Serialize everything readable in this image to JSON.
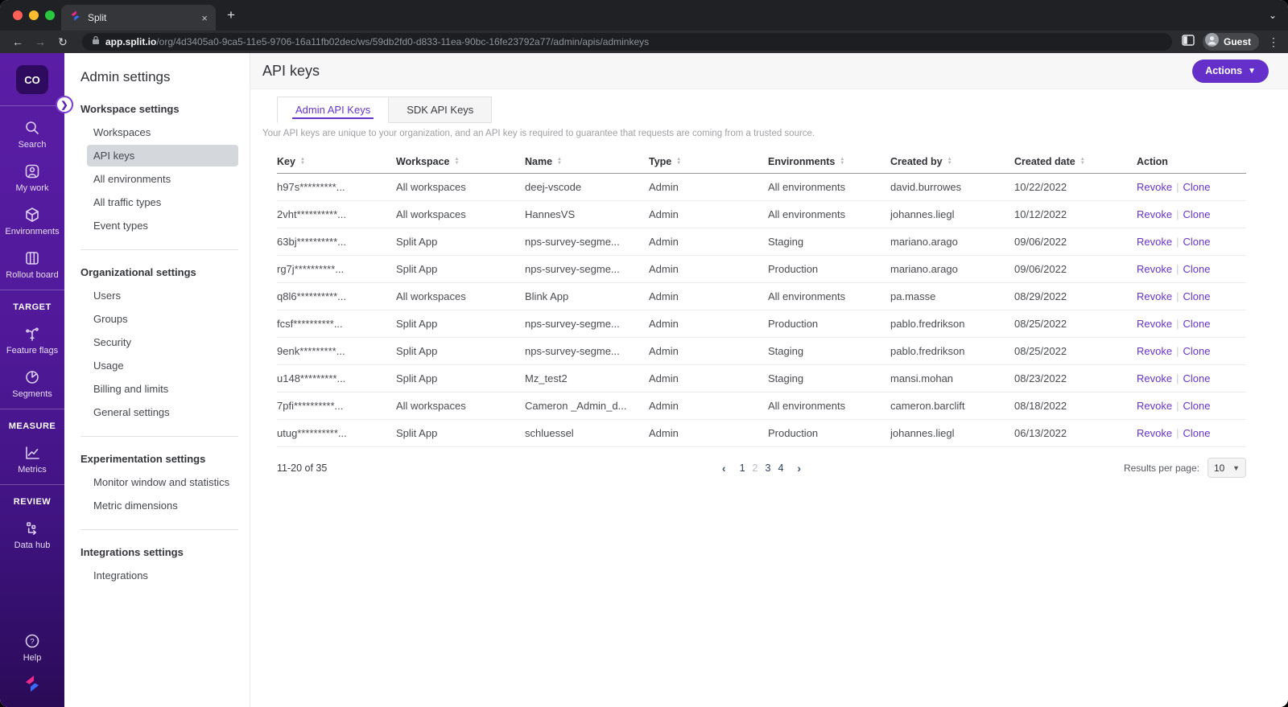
{
  "browser": {
    "tab_title": "Split",
    "new_tab_glyph": "+",
    "close_glyph": "×",
    "back_glyph": "←",
    "forward_glyph": "→",
    "reload_glyph": "↻",
    "url_domain": "app.split.io",
    "url_path": "/org/4d3405a0-9ca5-11e5-9706-16a11fb02dec/ws/59db2fd0-d833-11ea-90bc-16fe23792a77/admin/apis/adminkeys",
    "profile_label": "Guest",
    "kebab_glyph": "⋮",
    "strip_chevron_glyph": "⌄"
  },
  "rail": {
    "logo_text": "CO",
    "expander_glyph": "❯",
    "groups": [
      {
        "header": null,
        "items": [
          {
            "icon": "search-icon",
            "label": "Search"
          },
          {
            "icon": "my-work-icon",
            "label": "My work"
          },
          {
            "icon": "environments-cube-icon",
            "label": "Environments"
          },
          {
            "icon": "rollout-board-icon",
            "label": "Rollout board"
          }
        ]
      },
      {
        "header": "TARGET",
        "items": [
          {
            "icon": "feature-flags-icon",
            "label": "Feature flags"
          },
          {
            "icon": "segments-pie-icon",
            "label": "Segments"
          }
        ]
      },
      {
        "header": "MEASURE",
        "items": [
          {
            "icon": "metrics-chart-icon",
            "label": "Metrics"
          }
        ]
      },
      {
        "header": "REVIEW",
        "items": [
          {
            "icon": "data-hub-icon",
            "label": "Data hub"
          }
        ]
      }
    ],
    "help_label": "Help"
  },
  "admin_nav": {
    "title": "Admin settings",
    "groups": [
      {
        "header": "Workspace settings",
        "selected": "API keys",
        "items": [
          "Workspaces",
          "API keys",
          "All environments",
          "All traffic types",
          "Event types"
        ]
      },
      {
        "header": "Organizational settings",
        "selected": null,
        "items": [
          "Users",
          "Groups",
          "Security",
          "Usage",
          "Billing and limits",
          "General settings"
        ]
      },
      {
        "header": "Experimentation settings",
        "selected": null,
        "items": [
          "Monitor window and statistics",
          "Metric dimensions"
        ]
      },
      {
        "header": "Integrations settings",
        "selected": null,
        "items": [
          "Integrations"
        ]
      }
    ]
  },
  "main": {
    "title": "API keys",
    "actions_label": "Actions",
    "tabs": [
      {
        "label": "Admin API Keys",
        "active": true
      },
      {
        "label": "SDK API Keys",
        "active": false
      }
    ],
    "description": "Your API keys are unique to your organization, and an API key is required to guarantee that requests are coming from a trusted source.",
    "table": {
      "columns": [
        {
          "label": "Key",
          "sortable": true
        },
        {
          "label": "Workspace",
          "sortable": true
        },
        {
          "label": "Name",
          "sortable": true
        },
        {
          "label": "Type",
          "sortable": true
        },
        {
          "label": "Environments",
          "sortable": true
        },
        {
          "label": "Created by",
          "sortable": true
        },
        {
          "label": "Created date",
          "sortable": true
        },
        {
          "label": "Action",
          "sortable": false
        }
      ],
      "row_actions": [
        "Revoke",
        "Clone"
      ],
      "rows": [
        [
          "h97s*********...",
          "All workspaces",
          "deej-vscode",
          "Admin",
          "All environments",
          "david.burrowes",
          "10/22/2022"
        ],
        [
          "2vht**********...",
          "All workspaces",
          "HannesVS",
          "Admin",
          "All environments",
          "johannes.liegl",
          "10/12/2022"
        ],
        [
          "63bj**********...",
          "Split App",
          "nps-survey-segme...",
          "Admin",
          "Staging",
          "mariano.arago",
          "09/06/2022"
        ],
        [
          "rg7j**********...",
          "Split App",
          "nps-survey-segme...",
          "Admin",
          "Production",
          "mariano.arago",
          "09/06/2022"
        ],
        [
          "q8l6**********...",
          "All workspaces",
          "Blink App",
          "Admin",
          "All environments",
          "pa.masse",
          "08/29/2022"
        ],
        [
          "fcsf**********...",
          "Split App",
          "nps-survey-segme...",
          "Admin",
          "Production",
          "pablo.fredrikson",
          "08/25/2022"
        ],
        [
          "9enk*********...",
          "Split App",
          "nps-survey-segme...",
          "Admin",
          "Staging",
          "pablo.fredrikson",
          "08/25/2022"
        ],
        [
          "u148*********...",
          "Split App",
          "Mz_test2",
          "Admin",
          "Staging",
          "mansi.mohan",
          "08/23/2022"
        ],
        [
          "7pfi**********...",
          "All workspaces",
          "Cameron _Admin_d...",
          "Admin",
          "All environments",
          "cameron.barclift",
          "08/18/2022"
        ],
        [
          "utug**********...",
          "Split App",
          "schluessel",
          "Admin",
          "Production",
          "johannes.liegl",
          "06/13/2022"
        ]
      ]
    },
    "pagination": {
      "summary": "11-20 of 35",
      "prev_glyph": "‹",
      "next_glyph": "›",
      "pages": [
        "1",
        "2",
        "3",
        "4"
      ],
      "current_page": "2",
      "results_per_page_label": "Results per page:",
      "results_per_page_value": "10"
    }
  },
  "colors": {
    "accent_purple": "#6633cc",
    "actions_button": "#6430c9",
    "rail_gradient_top": "#5a1da5",
    "rail_gradient_bottom": "#2a0b57",
    "selected_nav_bg": "#d4d7dc",
    "header_band": "#f7f7f8",
    "traffic_red": "#ff5f57",
    "traffic_yellow": "#febc2e",
    "traffic_green": "#28c840"
  }
}
